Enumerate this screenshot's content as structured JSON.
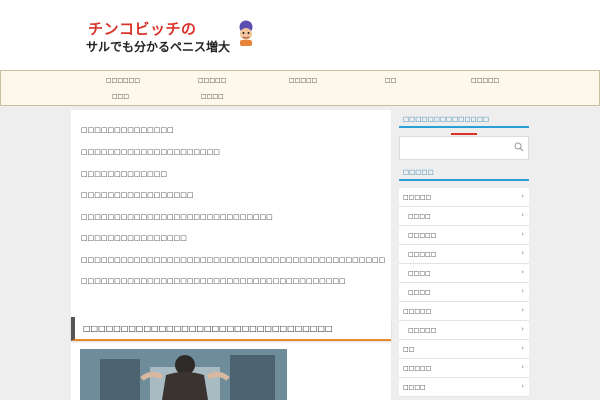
{
  "header": {
    "logo_line1": "チンコビッチの",
    "logo_line2": "サルでも分かるペニス増大"
  },
  "nav": {
    "items": [
      "□□□□□□",
      "□□□□□",
      "□□□□□",
      "□□",
      "□□□□□",
      "□□□",
      "□□□□"
    ]
  },
  "main": {
    "lines": [
      "□□□□□□□□□□□□□□",
      "□□□□□□□□□□□□□□□□□□□□□",
      "□□□□□□□□□□□□□",
      "□□□□□□□□□□□□□□□□□",
      "□□□□□□□□□□□□□□□□□□□□□□□□□□□□□",
      "□□□□□□□□□□□□□□□□",
      "□□□□□□□□□□□□□□□□□□□□□□□□□□□□□□□□□□□□□□□□□□□□□□",
      "□□□□□□□□□□□□□□□□□□□□□□□□□□□□□□□□□□□□□□□□"
    ],
    "heading": "□□□□□□□□□□□□□□□□□□□□□□□□□□□□□□□□□"
  },
  "sidebar": {
    "search_title": "□□□□□□□□□□□□□□",
    "category_title": "□□□□□",
    "categories": [
      {
        "label": "□□□□□",
        "level": 0
      },
      {
        "label": "□□□□",
        "level": 1
      },
      {
        "label": "□□□□□",
        "level": 1
      },
      {
        "label": "□□□□□",
        "level": 1
      },
      {
        "label": "□□□□",
        "level": 1
      },
      {
        "label": "□□□□",
        "level": 1
      },
      {
        "label": "□□□□□",
        "level": 0
      },
      {
        "label": "□□□□□",
        "level": 1
      },
      {
        "label": "□□",
        "level": 0
      },
      {
        "label": "□□□□□",
        "level": 0
      },
      {
        "label": "□□□□",
        "level": 0
      }
    ]
  },
  "colors": {
    "accent_blue": "#2a9fd6",
    "accent_orange": "#e88a2a",
    "logo_red": "#d9332a",
    "nav_bg": "#fcf8ec"
  },
  "icons": {
    "search": "search-icon",
    "chevron": "chevron-right-icon"
  }
}
